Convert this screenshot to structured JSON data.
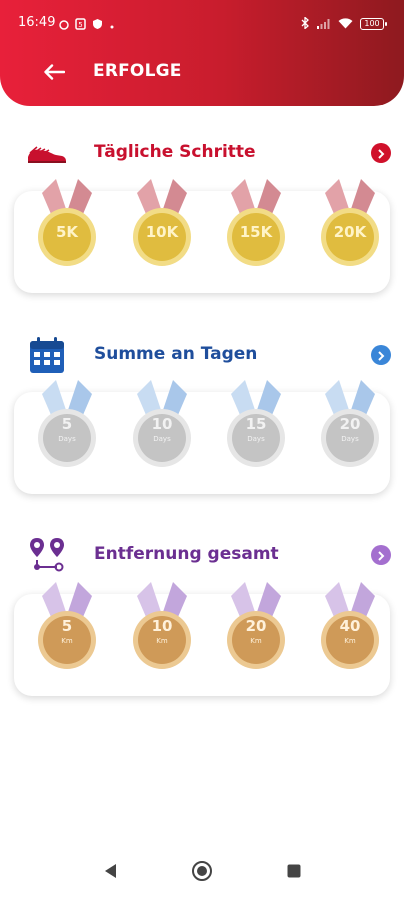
{
  "status": {
    "time": "16:49",
    "battery": "100"
  },
  "header": {
    "title": "ERFOLGE"
  },
  "colors": {
    "header_red": "#e8203a",
    "steps_title": "#c8102e",
    "days_title": "#1f4e9c",
    "distance_title": "#6b2f91",
    "gold": "#e8c24a",
    "silver": "#c9c9c9",
    "bronze": "#d6a667"
  },
  "sections": [
    {
      "title": "Tägliche Schritte",
      "icon": "shoe-icon",
      "medals": [
        {
          "value": "5K",
          "unit": ""
        },
        {
          "value": "10K",
          "unit": ""
        },
        {
          "value": "15K",
          "unit": ""
        },
        {
          "value": "20K",
          "unit": ""
        }
      ]
    },
    {
      "title": "Summe an Tagen",
      "icon": "calendar-icon",
      "medals": [
        {
          "value": "5",
          "unit": "Days"
        },
        {
          "value": "10",
          "unit": "Days"
        },
        {
          "value": "15",
          "unit": "Days"
        },
        {
          "value": "20",
          "unit": "Days"
        }
      ]
    },
    {
      "title": "Entfernung gesamt",
      "icon": "route-icon",
      "medals": [
        {
          "value": "5",
          "unit": "Km"
        },
        {
          "value": "10",
          "unit": "Km"
        },
        {
          "value": "20",
          "unit": "Km"
        },
        {
          "value": "40",
          "unit": "Km"
        }
      ]
    }
  ]
}
